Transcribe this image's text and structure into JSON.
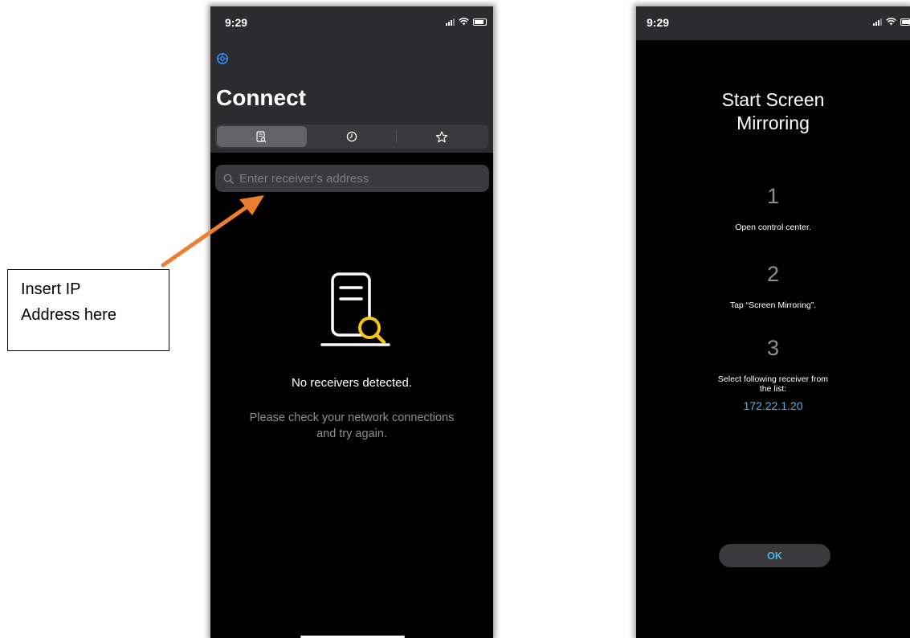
{
  "left_phone": {
    "status_time": "9:29",
    "title": "Connect",
    "tabs": [
      {
        "icon": "document-search-icon",
        "active": true
      },
      {
        "icon": "clock-icon",
        "active": false
      },
      {
        "icon": "star-icon",
        "active": false
      }
    ],
    "search_placeholder": "Enter receiver's address",
    "empty_title": "No receivers detected.",
    "empty_line1": "Please check your network connections",
    "empty_line2": "and try again."
  },
  "right_phone": {
    "status_time": "9:29",
    "title_line1": "Start Screen",
    "title_line2": "Mirroring",
    "steps": [
      {
        "number": "1",
        "text_line1": "Open control center.",
        "text_line2": ""
      },
      {
        "number": "2",
        "text_line1": "Tap “Screen Mirroring”.",
        "text_line2": ""
      },
      {
        "number": "3",
        "text_line1": "Select following receiver from",
        "text_line2": "the list:"
      }
    ],
    "receiver_ip": "172.22.1.20",
    "ok_label": "OK"
  },
  "annotation": {
    "line1": "Insert IP",
    "line2": "Address here"
  },
  "colors": {
    "accent": "#4fb3e8",
    "arrow": "#ed7d31",
    "search_glass": "#f5c518"
  }
}
